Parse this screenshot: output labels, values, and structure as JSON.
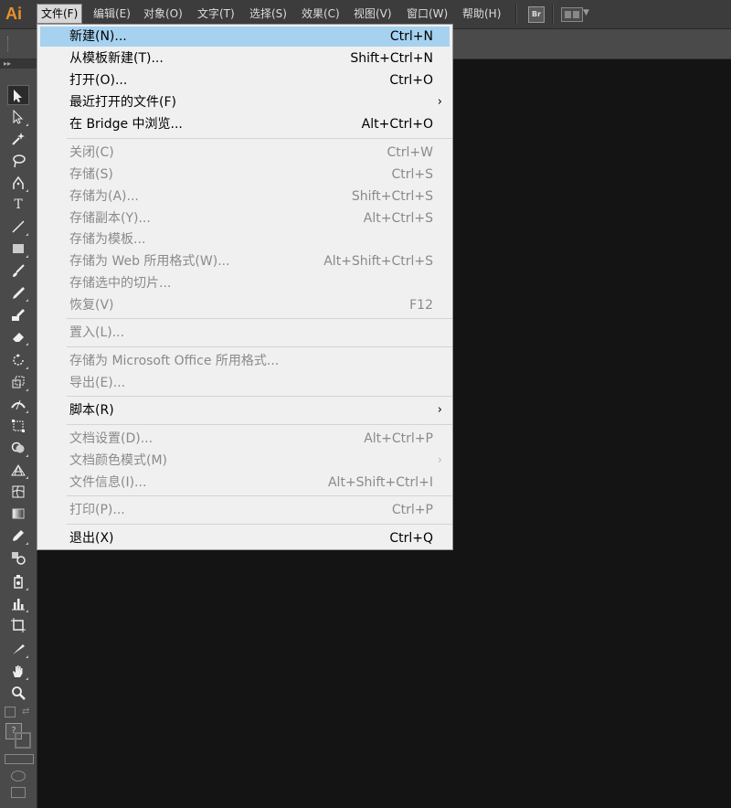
{
  "app": {
    "logo": "Ai"
  },
  "menubar": {
    "items": [
      {
        "label": "文件(F)"
      },
      {
        "label": "编辑(E)"
      },
      {
        "label": "对象(O)"
      },
      {
        "label": "文字(T)"
      },
      {
        "label": "选择(S)"
      },
      {
        "label": "效果(C)"
      },
      {
        "label": "视图(V)"
      },
      {
        "label": "窗口(W)"
      },
      {
        "label": "帮助(H)"
      }
    ],
    "bridge_label": "Br"
  },
  "file_menu": {
    "items": [
      {
        "label": "新建(N)...",
        "shortcut": "Ctrl+N"
      },
      {
        "label": "从模板新建(T)...",
        "shortcut": "Shift+Ctrl+N"
      },
      {
        "label": "打开(O)...",
        "shortcut": "Ctrl+O"
      },
      {
        "label": "最近打开的文件(F)",
        "shortcut": ""
      },
      {
        "label": "在 Bridge 中浏览...",
        "shortcut": "Alt+Ctrl+O"
      },
      {
        "label": "关闭(C)",
        "shortcut": "Ctrl+W"
      },
      {
        "label": "存储(S)",
        "shortcut": "Ctrl+S"
      },
      {
        "label": "存储为(A)...",
        "shortcut": "Shift+Ctrl+S"
      },
      {
        "label": "存储副本(Y)...",
        "shortcut": "Alt+Ctrl+S"
      },
      {
        "label": "存储为模板...",
        "shortcut": ""
      },
      {
        "label": "存储为 Web 所用格式(W)...",
        "shortcut": "Alt+Shift+Ctrl+S"
      },
      {
        "label": "存储选中的切片...",
        "shortcut": ""
      },
      {
        "label": "恢复(V)",
        "shortcut": "F12"
      },
      {
        "label": "置入(L)...",
        "shortcut": ""
      },
      {
        "label": "存储为 Microsoft Office 所用格式...",
        "shortcut": ""
      },
      {
        "label": "导出(E)...",
        "shortcut": ""
      },
      {
        "label": "脚本(R)",
        "shortcut": ""
      },
      {
        "label": "文档设置(D)...",
        "shortcut": "Alt+Ctrl+P"
      },
      {
        "label": "文档颜色模式(M)",
        "shortcut": ""
      },
      {
        "label": "文件信息(I)...",
        "shortcut": "Alt+Shift+Ctrl+I"
      },
      {
        "label": "打印(P)...",
        "shortcut": "Ctrl+P"
      },
      {
        "label": "退出(X)",
        "shortcut": "Ctrl+Q"
      }
    ],
    "submenu_arrow": "›"
  },
  "toolbar": {
    "tools": [
      {
        "icon": "selection-tool-icon"
      },
      {
        "icon": "direct-selection-tool-icon"
      },
      {
        "icon": "magic-wand-tool-icon"
      },
      {
        "icon": "lasso-tool-icon"
      },
      {
        "icon": "pen-tool-icon"
      },
      {
        "icon": "type-tool-icon",
        "glyph": "T"
      },
      {
        "icon": "line-segment-tool-icon"
      },
      {
        "icon": "rectangle-tool-icon"
      },
      {
        "icon": "paintbrush-tool-icon"
      },
      {
        "icon": "pencil-tool-icon"
      },
      {
        "icon": "blob-brush-tool-icon"
      },
      {
        "icon": "eraser-tool-icon"
      },
      {
        "icon": "rotate-tool-icon"
      },
      {
        "icon": "scale-tool-icon"
      },
      {
        "icon": "width-tool-icon"
      },
      {
        "icon": "free-transform-tool-icon"
      },
      {
        "icon": "shape-builder-tool-icon"
      },
      {
        "icon": "perspective-grid-tool-icon"
      },
      {
        "icon": "mesh-tool-icon"
      },
      {
        "icon": "gradient-tool-icon"
      },
      {
        "icon": "eyedropper-tool-icon"
      },
      {
        "icon": "blend-tool-icon"
      },
      {
        "icon": "symbol-sprayer-tool-icon"
      },
      {
        "icon": "column-graph-tool-icon"
      },
      {
        "icon": "artboard-tool-icon"
      },
      {
        "icon": "slice-tool-icon"
      },
      {
        "icon": "hand-tool-icon"
      },
      {
        "icon": "zoom-tool-icon"
      }
    ]
  },
  "colors": {
    "menu_highlight": "#a6d2f0",
    "app_logo": "#e8922a",
    "canvas_bg": "#141414"
  }
}
